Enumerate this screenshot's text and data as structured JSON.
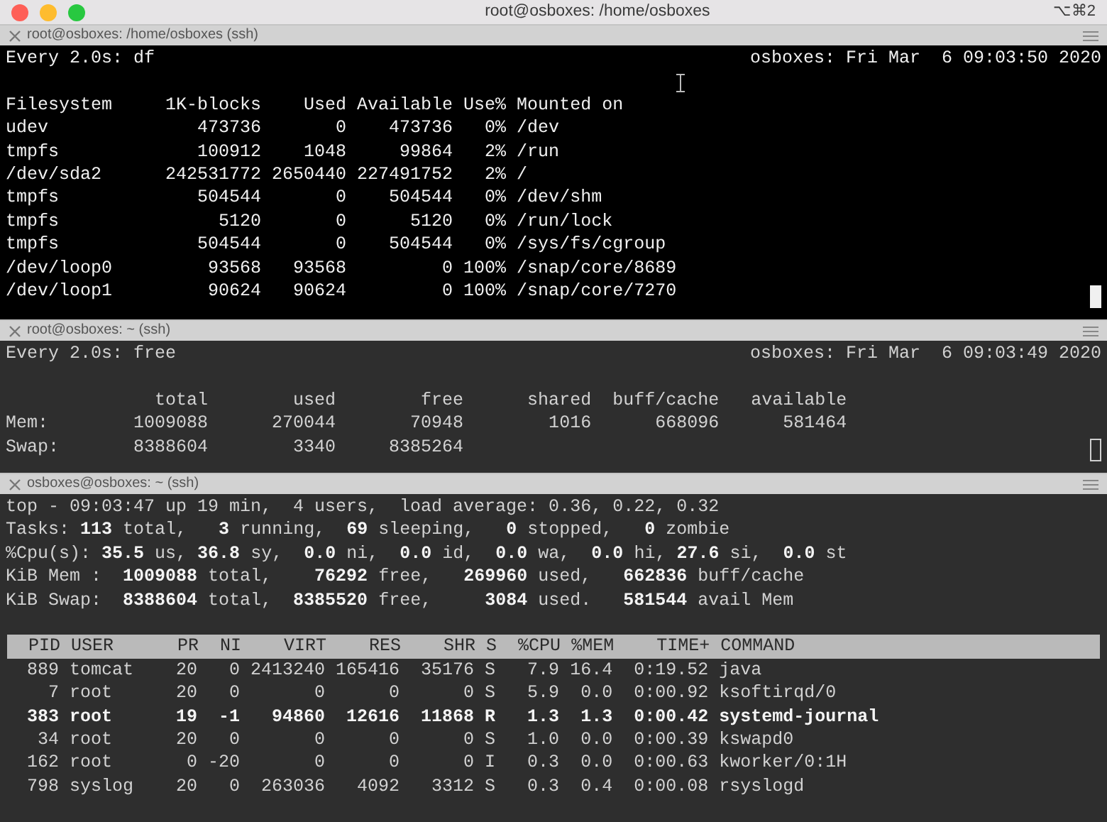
{
  "window": {
    "title": "root@osboxes: /home/osboxes",
    "shortcut": "⌥⌘2"
  },
  "panes": [
    {
      "tab": "root@osboxes: /home/osboxes (ssh)",
      "black_background": true,
      "command": "Every 2.0s: df",
      "clock": "osboxes: Fri Mar  6 09:03:50 2020",
      "cursor_filled": true,
      "mouse_pointer": true,
      "lines": [
        "Filesystem     1K-blocks    Used Available Use% Mounted on",
        "udev              473736       0    473736   0% /dev",
        "tmpfs             100912    1048     99864   2% /run",
        "/dev/sda2      242531772 2650440 227491752   2% /",
        "tmpfs             504544       0    504544   0% /dev/shm",
        "tmpfs               5120       0      5120   0% /run/lock",
        "tmpfs             504544       0    504544   0% /sys/fs/cgroup",
        "/dev/loop0         93568   93568         0 100% /snap/core/8689",
        "/dev/loop1         90624   90624         0 100% /snap/core/7270"
      ]
    },
    {
      "tab": "root@osboxes: ~ (ssh)",
      "black_background": false,
      "command": "Every 2.0s: free",
      "clock": "osboxes: Fri Mar  6 09:03:49 2020",
      "cursor_filled": false,
      "lines": [
        "              total        used        free      shared  buff/cache   available",
        "Mem:        1009088      270044       70948        1016      668096      581464",
        "Swap:       8388604        3340     8385264"
      ]
    },
    {
      "tab": "osboxes@osboxes: ~ (ssh)",
      "black_background": false,
      "summary": [
        "top - 09:03:47 up 19 min,  4 users,  load average: 0.36, 0.22, 0.32",
        "Tasks: **113** total,   **3** running,  **69** sleeping,   **0** stopped,   **0** zombie",
        "%Cpu(s): **35.5** us, **36.8** sy,  **0.0** ni,  **0.0** id,  **0.0** wa,  **0.0** hi, **27.6** si,  **0.0** st",
        "KiB Mem :  **1009088** total,    **76292** free,   **269960** used,   **662836** buff/cache",
        "KiB Swap:  **8388604** total,  **8385520** free,     **3084** used.   **581544** avail Mem"
      ],
      "process_header": "  PID USER      PR  NI    VIRT    RES    SHR S  %CPU %MEM    TIME+ COMMAND",
      "processes": [
        {
          "text": "  889 tomcat    20   0 2413240 165416  35176 S   7.9 16.4  0:19.52 java",
          "highlighted": false
        },
        {
          "text": "    7 root      20   0       0      0      0 S   5.9  0.0  0:00.92 ksoftirqd/0",
          "highlighted": false
        },
        {
          "text": "  383 root      19  -1   94860  12616  11868 R   1.3  1.3  0:00.42 systemd-journal",
          "highlighted": true
        },
        {
          "text": "   34 root      20   0       0      0      0 S   1.0  0.0  0:00.39 kswapd0",
          "highlighted": false
        },
        {
          "text": "  162 root       0 -20       0      0      0 I   0.3  0.0  0:00.63 kworker/0:1H",
          "highlighted": false
        },
        {
          "text": "  798 syslog    20   0  263036   4092   3312 S   0.3  0.4  0:00.08 rsyslogd",
          "highlighted": false
        }
      ]
    }
  ]
}
